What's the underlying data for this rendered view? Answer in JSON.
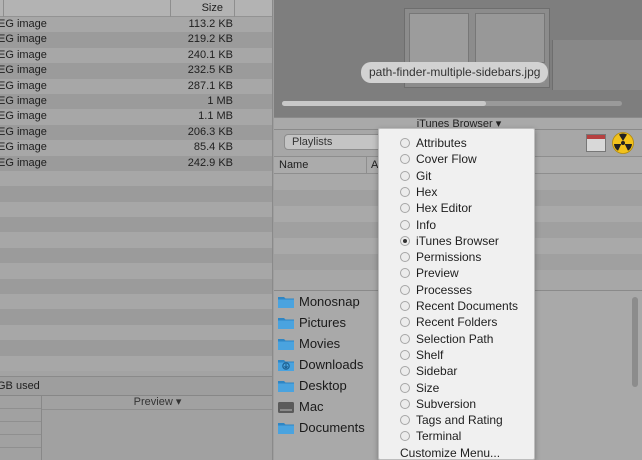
{
  "left_pane": {
    "size_header": "Size",
    "files": [
      {
        "kind": "EG image",
        "size": "113.2 KB"
      },
      {
        "kind": "EG image",
        "size": "219.2 KB"
      },
      {
        "kind": "EG image",
        "size": "240.1 KB"
      },
      {
        "kind": "EG image",
        "size": "232.5 KB"
      },
      {
        "kind": "EG image",
        "size": "287.1 KB"
      },
      {
        "kind": "EG image",
        "size": "1 MB"
      },
      {
        "kind": "EG image",
        "size": "1.1 MB"
      },
      {
        "kind": "EG image",
        "size": "206.3 KB"
      },
      {
        "kind": "EG image",
        "size": "85.4 KB"
      },
      {
        "kind": "EG image",
        "size": "242.9 KB"
      }
    ],
    "status": "GB used",
    "preview_header": "Preview ▾"
  },
  "preview": {
    "caption": "path-finder-multiple-sidebars.jpg",
    "progress": 0.6
  },
  "browser": {
    "title": "iTunes Browser ▾",
    "playlists_label": "Playlists",
    "col_name": "Name",
    "col_artist": "Ar"
  },
  "folders": [
    {
      "name": "Monosnap",
      "icon": "folder-icon"
    },
    {
      "name": "Pictures",
      "icon": "folder-icon"
    },
    {
      "name": "Movies",
      "icon": "folder-icon"
    },
    {
      "name": "Downloads",
      "icon": "downloads-folder-icon"
    },
    {
      "name": "Desktop",
      "icon": "folder-icon"
    },
    {
      "name": "Mac",
      "icon": "hard-drive-icon"
    },
    {
      "name": "Documents",
      "icon": "folder-icon"
    }
  ],
  "menu": {
    "items": [
      {
        "label": "Attributes",
        "selected": false
      },
      {
        "label": "Cover Flow",
        "selected": false
      },
      {
        "label": "Git",
        "selected": false
      },
      {
        "label": "Hex",
        "selected": false
      },
      {
        "label": "Hex Editor",
        "selected": false
      },
      {
        "label": "Info",
        "selected": false
      },
      {
        "label": "iTunes Browser",
        "selected": true
      },
      {
        "label": "Permissions",
        "selected": false
      },
      {
        "label": "Preview",
        "selected": false
      },
      {
        "label": "Processes",
        "selected": false
      },
      {
        "label": "Recent Documents",
        "selected": false
      },
      {
        "label": "Recent Folders",
        "selected": false
      },
      {
        "label": "Selection Path",
        "selected": false
      },
      {
        "label": "Shelf",
        "selected": false
      },
      {
        "label": "Sidebar",
        "selected": false
      },
      {
        "label": "Size",
        "selected": false
      },
      {
        "label": "Subversion",
        "selected": false
      },
      {
        "label": "Tags and Rating",
        "selected": false
      },
      {
        "label": "Terminal",
        "selected": false
      }
    ],
    "customize": "Customize Menu..."
  },
  "colors": {
    "folder_blue": "#4aa3df",
    "folder_blue_dark": "#2f86c4",
    "radioactive_yellow": "#f2c21b"
  }
}
